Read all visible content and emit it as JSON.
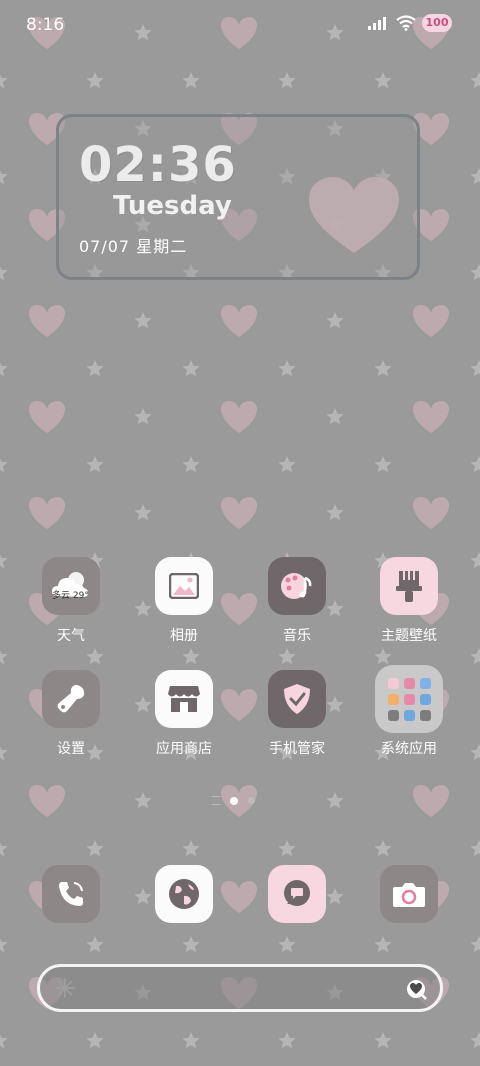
{
  "status_bar": {
    "time": "8:16",
    "battery": "100",
    "icons": [
      "signal-icon",
      "wifi-icon",
      "battery-icon"
    ]
  },
  "clock_widget": {
    "time": "02:36",
    "day": "Tuesday",
    "date": "07/07  星期二"
  },
  "apps": {
    "row1": [
      {
        "label": "天气",
        "icon": "weather-icon",
        "weather_text": "多云 29°"
      },
      {
        "label": "相册",
        "icon": "gallery-icon"
      },
      {
        "label": "音乐",
        "icon": "music-icon"
      },
      {
        "label": "主题壁纸",
        "icon": "theme-brush-icon"
      }
    ],
    "row2": [
      {
        "label": "设置",
        "icon": "settings-wrench-icon"
      },
      {
        "label": "应用商店",
        "icon": "app-store-icon"
      },
      {
        "label": "手机管家",
        "icon": "security-shield-icon"
      },
      {
        "label": "系统应用",
        "icon": "folder-icon"
      }
    ]
  },
  "dock": [
    {
      "icon": "phone-icon"
    },
    {
      "icon": "browser-globe-icon"
    },
    {
      "icon": "messages-icon"
    },
    {
      "icon": "camera-icon"
    }
  ],
  "page_indicator": {
    "pages": 2,
    "active": 1
  },
  "colors": {
    "wallpaper": "#9a9a9a",
    "heart": "#c4aeb4",
    "star": "#b6b6b6",
    "icon_dark": "#6f6769",
    "icon_pink": "#f7d7e0",
    "icon_white": "#fbfbfb"
  }
}
